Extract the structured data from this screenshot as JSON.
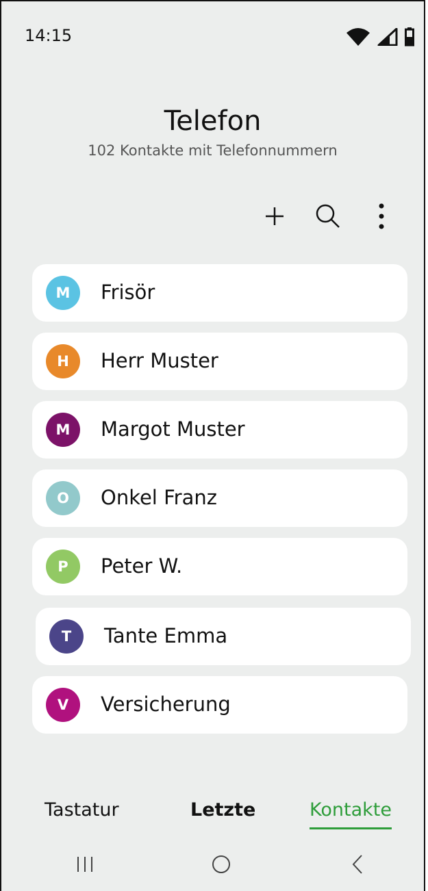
{
  "status_bar": {
    "time": "14:15",
    "icons": [
      "wifi-icon",
      "signal-icon",
      "battery-icon"
    ]
  },
  "header": {
    "title": "Telefon",
    "subtitle": "102 Kontakte mit Telefonnummern"
  },
  "toolbar": {
    "icons": [
      "plus-icon",
      "search-icon",
      "more-vertical-icon"
    ]
  },
  "contacts": [
    {
      "initial": "M",
      "name": "Frisör",
      "color": "#5bc3e3"
    },
    {
      "initial": "H",
      "name": "Herr Muster",
      "color": "#e8892a"
    },
    {
      "initial": "M",
      "name": "Margot Muster",
      "color": "#7c1268"
    },
    {
      "initial": "O",
      "name": "Onkel Franz",
      "color": "#92c9cb"
    },
    {
      "initial": "P",
      "name": "Peter W.",
      "color": "#92c964"
    },
    {
      "initial": "T",
      "name": "Tante Emma",
      "color": "#4b4589"
    },
    {
      "initial": "V",
      "name": "Versicherung",
      "color": "#b0117e"
    }
  ],
  "tabs": [
    {
      "label": "Tastatur"
    },
    {
      "label": "Letzte"
    },
    {
      "label": "Kontakte"
    }
  ],
  "navbar": {
    "icons": [
      "recent-apps-icon",
      "home-icon",
      "back-icon"
    ]
  },
  "colors": {
    "background": "#eceeed",
    "accent": "#2e9d3a",
    "card": "#ffffff"
  }
}
